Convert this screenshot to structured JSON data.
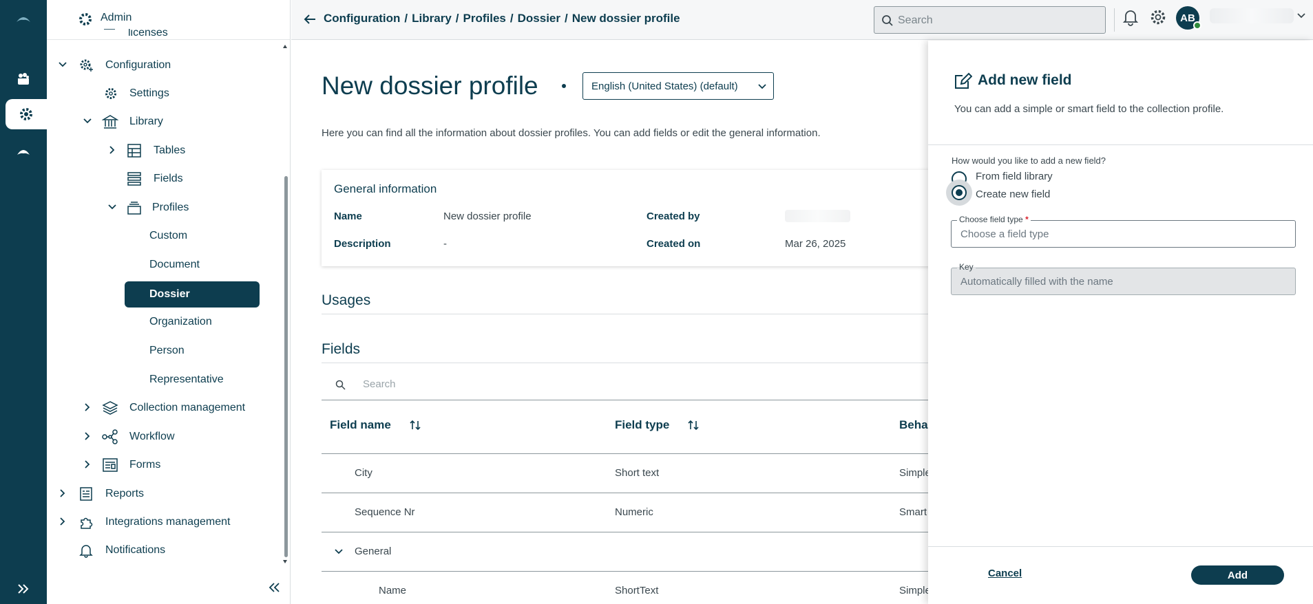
{
  "header": {
    "breadcrumbs": [
      "Configuration",
      "/",
      "Library",
      "/",
      "Profiles",
      "/",
      "Dossier",
      "/",
      "New dossier profile"
    ],
    "search_placeholder": "Search",
    "avatar_initials": "AB"
  },
  "sidebar": {
    "title": "Admin",
    "items": [
      {
        "label": "licenses"
      },
      {
        "label": "Configuration"
      },
      {
        "label": "Settings"
      },
      {
        "label": "Library"
      },
      {
        "label": "Tables"
      },
      {
        "label": "Fields"
      },
      {
        "label": "Profiles"
      },
      {
        "label": "Custom"
      },
      {
        "label": "Document"
      },
      {
        "label": "Dossier",
        "selected": true
      },
      {
        "label": "Organization"
      },
      {
        "label": "Person"
      },
      {
        "label": "Representative"
      },
      {
        "label": "Collection management"
      },
      {
        "label": "Workflow"
      },
      {
        "label": "Forms"
      },
      {
        "label": "Reports"
      },
      {
        "label": "Integrations management"
      },
      {
        "label": "Notifications"
      }
    ]
  },
  "main": {
    "title": "New dossier profile",
    "language": "English (United States) (default)",
    "intro": "Here you can find all the information about dossier profiles. You can add fields or edit the general information.",
    "general": {
      "heading": "General information",
      "name_label": "Name",
      "name_value": "New dossier profile",
      "description_label": "Description",
      "description_value": "-",
      "created_by_label": "Created by",
      "created_on_label": "Created on",
      "created_on_value": "Mar 26, 2025"
    },
    "usages_heading": "Usages",
    "fields_heading": "Fields",
    "table": {
      "search_placeholder": "Search",
      "columns": [
        "Field name",
        "Field type",
        "Beha"
      ],
      "rows": [
        {
          "name": "City",
          "type": "Short text",
          "behavior": "Simple"
        },
        {
          "name": "Sequence Nr",
          "type": "Numeric",
          "behavior": "Smart"
        },
        {
          "name": "General",
          "type": "",
          "behavior": ""
        },
        {
          "name": "Name",
          "type": "ShortText",
          "behavior": "Simple"
        }
      ]
    }
  },
  "panel": {
    "title": "Add new field",
    "subtitle": "You can add a simple or smart field to the collection profile.",
    "question": "How would you like to add a new field?",
    "options": [
      "From field library",
      "Create new field"
    ],
    "selected_option": "Create new field",
    "field_type_label": "Choose field type",
    "field_type_required": "*",
    "field_type_placeholder": "Choose a field type",
    "key_label": "Key",
    "key_placeholder": "Automatically filled with the name",
    "cancel_label": "Cancel",
    "add_label": "Add"
  },
  "colors": {
    "primary": "#0d3d4f",
    "required": "#d9232e",
    "online": "#2f8a3c"
  }
}
